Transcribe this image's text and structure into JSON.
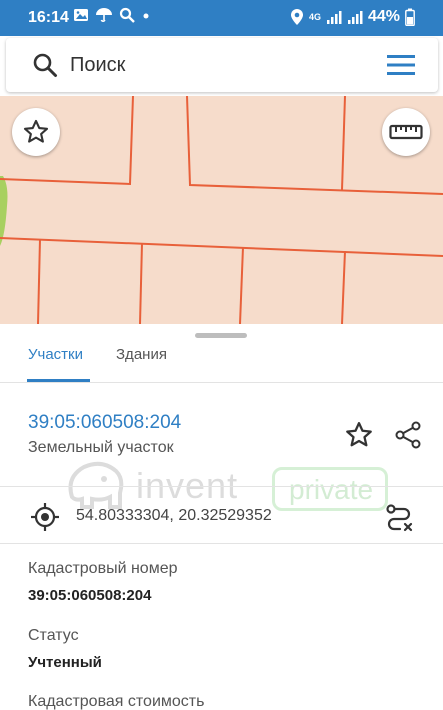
{
  "status_bar": {
    "time": "16:14",
    "network": "4G",
    "battery": "44%"
  },
  "search": {
    "placeholder": "Поиск"
  },
  "tabs": [
    {
      "label": "Участки",
      "active": true
    },
    {
      "label": "Здания",
      "active": false
    }
  ],
  "parcel": {
    "number": "39:05:060508:204",
    "type": "Земельный участок",
    "coordinates": "54.80333304, 20.32529352"
  },
  "fields": [
    {
      "label": "Кадастровый номер",
      "value": "39:05:060508:204"
    },
    {
      "label": "Статус",
      "value": "Учтенный"
    },
    {
      "label": "Кадастровая стоимость",
      "value": ""
    }
  ],
  "watermark": {
    "brand": "invent",
    "badge": "private"
  },
  "colors": {
    "accent": "#2f7fc4",
    "map_fill": "#f6dccb",
    "parcel_border": "#e8603a"
  }
}
